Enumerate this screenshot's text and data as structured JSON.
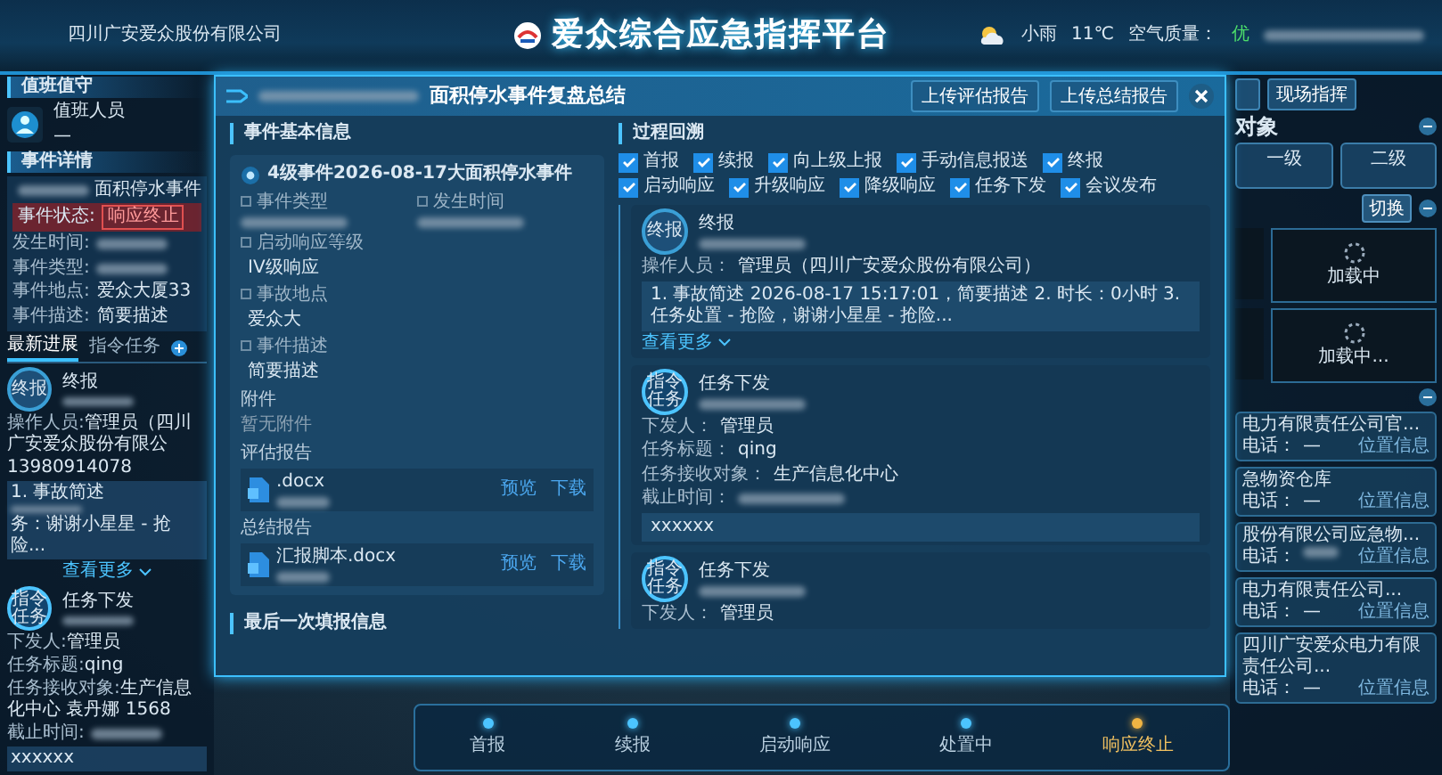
{
  "header": {
    "company": "四川广安爱众股份有限公司",
    "title": "爱众综合应急指挥平台",
    "weather": "小雨",
    "temperature": "11℃",
    "air_quality_label": "空气质量：",
    "air_quality": "优"
  },
  "left_panel": {
    "duty": {
      "title": "值班值守",
      "role": "值班人员",
      "name": "—"
    },
    "event": {
      "title": "事件详情",
      "name": "面积停水事件",
      "status_label": "事件状态:",
      "status": "响应终止",
      "fields": [
        {
          "label": "发生时间:"
        },
        {
          "label": "事件类型:"
        },
        {
          "label": "事件地点:",
          "value": "爱众大厦33"
        },
        {
          "label": "事件描述:",
          "value": "简要描述"
        }
      ]
    },
    "tabs": [
      {
        "label": "最新进展",
        "selected": true
      },
      {
        "label": "指令任务",
        "selected": false
      }
    ],
    "items": [
      {
        "kind": "report",
        "badge": "终报",
        "title": "终报",
        "fields": [
          {
            "label": "操作人员:",
            "value": "管理员（四川广安爱众股份有限公"
          },
          {
            "value": "13980914078"
          }
        ],
        "note_lines": [
          "1. 事故简述",
          "务：谢谢小星星 - 抢险..."
        ],
        "more": "查看更多"
      },
      {
        "kind": "task",
        "badge": "指令任务",
        "title": "任务下发",
        "fields": [
          {
            "label": "下发人:",
            "value": "管理员"
          },
          {
            "label": "任务标题:",
            "value": "qing"
          },
          {
            "label": "任务接收对象:",
            "value": "生产信息化中心 袁丹娜 1568"
          },
          {
            "label": "截止时间:"
          }
        ],
        "note_lines": [
          "xxxxxx"
        ]
      }
    ]
  },
  "modal": {
    "title": "面积停水事件复盘总结",
    "buttons": [
      "上传评估报告",
      "上传总结报告"
    ],
    "basic": {
      "section": "事件基本信息",
      "event_title": "4级事件2026-08-17大面积停水事件",
      "fields": [
        {
          "label": "事件类型"
        },
        {
          "label": "发生时间"
        },
        {
          "label": "启动响应等级",
          "value": "IV级响应"
        },
        {
          "label": "事故地点",
          "value": "爱众大"
        },
        {
          "label": "事件描述",
          "value": "简要描述"
        }
      ],
      "attachment_label": "附件",
      "attachment_empty": "暂无附件",
      "reports": [
        {
          "label": "评估报告",
          "file": ".docx",
          "actions": [
            "预览",
            "下载"
          ]
        },
        {
          "label": "总结报告",
          "file": "汇报脚本.docx",
          "actions": [
            "预览",
            "下载"
          ]
        }
      ]
    },
    "last_section": "最后一次填报信息",
    "review": {
      "section": "过程回溯",
      "filters": [
        {
          "label": "首报",
          "checked": true
        },
        {
          "label": "续报",
          "checked": true
        },
        {
          "label": "向上级上报",
          "checked": true
        },
        {
          "label": "手动信息报送",
          "checked": true
        },
        {
          "label": "终报",
          "checked": true
        },
        {
          "label": "启动响应",
          "checked": true
        },
        {
          "label": "升级响应",
          "checked": true
        },
        {
          "label": "降级响应",
          "checked": true
        },
        {
          "label": "任务下发",
          "checked": true
        },
        {
          "label": "会议发布",
          "checked": true
        }
      ],
      "records": [
        {
          "kind": "report",
          "badge": "终报",
          "title": "终报",
          "fields": [
            {
              "label": "操作人员：",
              "value": "管理员（四川广安爱众股份有限公司）"
            }
          ],
          "note": "1. 事故简述 2026-08-17 15:17:01，简要描述 2. 时长：0小时 3. 任务处置 - 抢险，谢谢小星星 - 抢险...",
          "more": "查看更多"
        },
        {
          "kind": "task",
          "badge": "指令任务",
          "title": "任务下发",
          "fields": [
            {
              "label": "下发人：",
              "value": "管理员"
            },
            {
              "label": "任务标题：",
              "value": "qing"
            },
            {
              "label": "任务接收对象：",
              "value": "生产信息化中心"
            },
            {
              "label": "截止时间："
            }
          ],
          "note": "xxxxxx"
        },
        {
          "kind": "task",
          "badge": "指令任务",
          "title": "任务下发",
          "fields": [
            {
              "label": "下发人：",
              "value": "管理员"
            }
          ]
        }
      ]
    }
  },
  "stepper": {
    "steps": [
      {
        "label": "首报",
        "selected": false
      },
      {
        "label": "续报",
        "selected": false
      },
      {
        "label": "启动响应",
        "selected": false
      },
      {
        "label": "处置中",
        "selected": false
      },
      {
        "label": "响应终止",
        "selected": true
      }
    ]
  },
  "right_panel": {
    "command_button": "现场指挥",
    "section": "对象",
    "levels": [
      "一级",
      "二级"
    ],
    "switch": "切换",
    "videos": [
      {
        "status": "加载中"
      },
      {
        "status": "加载中..."
      }
    ],
    "contacts": [
      {
        "name": "电力有限责任公司官...",
        "location": "位置信息",
        "phone_label": "电话：",
        "phone": "—"
      },
      {
        "name": "急物资仓库",
        "location": "位置信息",
        "phone_label": "电话：",
        "phone": "—"
      },
      {
        "name": "股份有限公司应急物...",
        "location": "位置信息",
        "phone_label": "电话："
      },
      {
        "name": "电力有限责任公司...",
        "location": "位置信息",
        "phone_label": "电话：",
        "phone": "—"
      },
      {
        "name": "四川广安爱众电力有限责任公司...",
        "location": "位置信息",
        "phone_label": "电话：",
        "phone": "—"
      }
    ]
  }
}
